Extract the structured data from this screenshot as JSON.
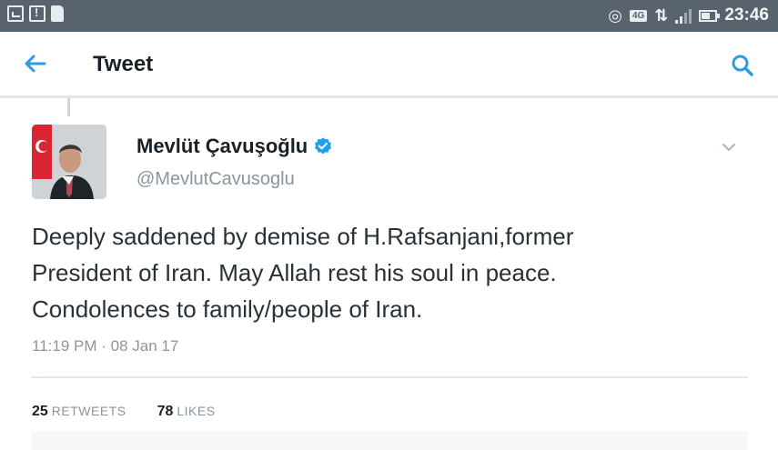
{
  "status_bar": {
    "time": "23:46",
    "network_badge": "4G",
    "icons_left": [
      "image-icon",
      "alert-icon",
      "sdcard-icon"
    ],
    "icons_right": [
      "wifi-hotspot-icon",
      "network-badge",
      "data-arrows-icon",
      "signal-icon",
      "battery-icon"
    ]
  },
  "app_bar": {
    "title": "Tweet",
    "back_icon": "back-arrow-icon",
    "search_icon": "search-icon",
    "accent_color": "#2b9be3"
  },
  "tweet": {
    "display_name": "Mevlüt Çavuşoğlu",
    "verified": true,
    "handle": "@MevlutCavusoglu",
    "text_lines": [
      "Deeply saddened by demise of H.Rafsanjani,former",
      "President of Iran. May Allah rest his soul in peace.",
      "Condolences to family/people of Iran."
    ],
    "timestamp": "11:19 PM · 08 Jan 17",
    "retweets_count": "25",
    "retweets_label": "RETWEETS",
    "likes_count": "78",
    "likes_label": "LIKES",
    "verified_color": "#1da1f2"
  }
}
